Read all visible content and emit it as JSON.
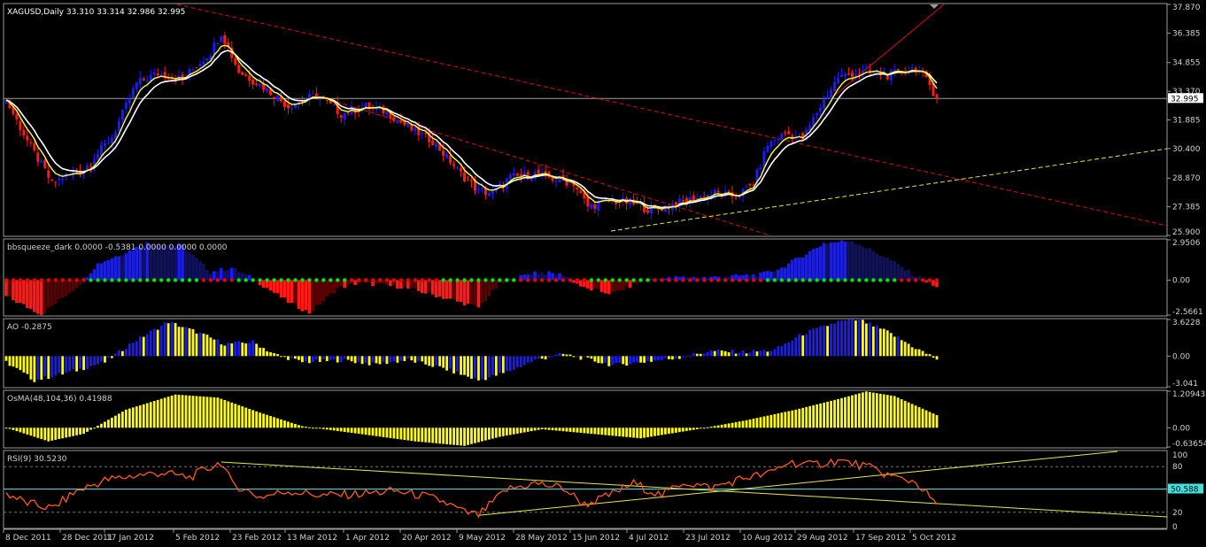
{
  "colors": {
    "background": "#000000",
    "bull": "#1a1aff",
    "bear": "#ff1a1a",
    "ema_fast": "#ffff33",
    "ema_slow": "#ffffff",
    "squeeze_on": "#00e600",
    "squeeze_off": "#e60000",
    "ao_yellow": "#ffff00",
    "ao_blue": "#1a1aff",
    "rsi_line": "#ff5a1a",
    "trend_red": "#d01010",
    "trend_yellow": "#e6e64a",
    "grid": "#777777"
  },
  "chart_data": [
    {
      "type": "candlestick",
      "title": "XAGUSD,Daily  33.310 33.314 32.986 32.995",
      "ylim": [
        25.9,
        37.87
      ],
      "y_ticks": [
        "37.870",
        "36.385",
        "34.855",
        "33.370",
        "31.885",
        "30.400",
        "28.870",
        "27.385",
        "25.900"
      ],
      "last_price": "32.995",
      "x_labels": [
        "8 Dec 2011",
        "28 Dec 2011",
        "17 Jan 2012",
        "5 Feb 2012",
        "23 Feb 2012",
        "13 Mar 2012",
        "1 Apr 2012",
        "20 Apr 2012",
        "9 May 2012",
        "28 May 2012",
        "15 Jun 2012",
        "4 Jul 2012",
        "23 Jul 2012",
        "10 Aug 2012",
        "29 Aug 2012",
        "17 Sep 2012",
        "5 Oct 2012"
      ],
      "close_anchors": [
        [
          0,
          32.9
        ],
        [
          6,
          30.8
        ],
        [
          13,
          28.6
        ],
        [
          17,
          29.0
        ],
        [
          22,
          29.3
        ],
        [
          30,
          31.0
        ],
        [
          37,
          33.8
        ],
        [
          43,
          34.3
        ],
        [
          50,
          34.0
        ],
        [
          58,
          35.4
        ],
        [
          61,
          36.4
        ],
        [
          66,
          34.4
        ],
        [
          73,
          33.6
        ],
        [
          80,
          32.6
        ],
        [
          88,
          33.2
        ],
        [
          95,
          32.2
        ],
        [
          102,
          32.6
        ],
        [
          108,
          32.3
        ],
        [
          114,
          31.5
        ],
        [
          121,
          30.8
        ],
        [
          129,
          29.1
        ],
        [
          134,
          28.2
        ],
        [
          138,
          28.1
        ],
        [
          143,
          28.9
        ],
        [
          150,
          29.1
        ],
        [
          156,
          28.8
        ],
        [
          161,
          28.6
        ],
        [
          165,
          27.4
        ],
        [
          171,
          27.7
        ],
        [
          177,
          27.6
        ],
        [
          183,
          27.2
        ],
        [
          189,
          27.5
        ],
        [
          195,
          27.8
        ],
        [
          201,
          28.1
        ],
        [
          207,
          27.9
        ],
        [
          212,
          28.6
        ],
        [
          216,
          30.6
        ],
        [
          221,
          31.2
        ],
        [
          226,
          30.9
        ],
        [
          231,
          32.6
        ],
        [
          236,
          34.1
        ],
        [
          241,
          34.3
        ],
        [
          246,
          34.4
        ],
        [
          250,
          34.2
        ],
        [
          254,
          34.4
        ],
        [
          258,
          34.6
        ],
        [
          262,
          33.7
        ],
        [
          264,
          32.995
        ]
      ]
    },
    {
      "type": "histogram",
      "title": "bbsqueeze_dark 0.0000 -0.5381 0.0000 0.0000 0.0000",
      "ylim": [
        -2.5661,
        2.9506
      ],
      "y_ticks": [
        "2.9506",
        "0.00",
        "-2.5661"
      ]
    },
    {
      "type": "histogram",
      "title": "AO -0.2875",
      "ylim": [
        -3.041,
        3.6228
      ],
      "y_ticks": [
        "3.6228",
        "0.00",
        "-3.041"
      ]
    },
    {
      "type": "histogram",
      "title": "OsMA(48,104,36) 0.41988",
      "ylim": [
        -0.63654,
        1.20943
      ],
      "y_ticks": [
        "1.20943",
        "0.00",
        "-0.63654"
      ]
    },
    {
      "type": "line",
      "title": "RSI(9) 30.5230",
      "ylim": [
        0,
        100
      ],
      "y_ticks": [
        "100",
        "80",
        "20",
        "0"
      ],
      "levels": [
        20,
        50.588,
        80
      ],
      "level_label": "50.588",
      "rsi_anchors": [
        [
          0,
          45
        ],
        [
          6,
          32
        ],
        [
          13,
          25
        ],
        [
          20,
          48
        ],
        [
          28,
          62
        ],
        [
          36,
          68
        ],
        [
          44,
          72
        ],
        [
          52,
          66
        ],
        [
          61,
          86
        ],
        [
          64,
          58
        ],
        [
          72,
          40
        ],
        [
          80,
          48
        ],
        [
          90,
          42
        ],
        [
          100,
          44
        ],
        [
          110,
          48
        ],
        [
          118,
          42
        ],
        [
          124,
          34
        ],
        [
          130,
          20
        ],
        [
          134,
          16
        ],
        [
          142,
          50
        ],
        [
          150,
          58
        ],
        [
          158,
          52
        ],
        [
          164,
          30
        ],
        [
          170,
          40
        ],
        [
          178,
          58
        ],
        [
          186,
          42
        ],
        [
          192,
          60
        ],
        [
          200,
          52
        ],
        [
          210,
          66
        ],
        [
          216,
          70
        ],
        [
          222,
          86
        ],
        [
          228,
          82
        ],
        [
          236,
          88
        ],
        [
          244,
          80
        ],
        [
          252,
          66
        ],
        [
          258,
          60
        ],
        [
          264,
          30.5
        ]
      ]
    }
  ]
}
